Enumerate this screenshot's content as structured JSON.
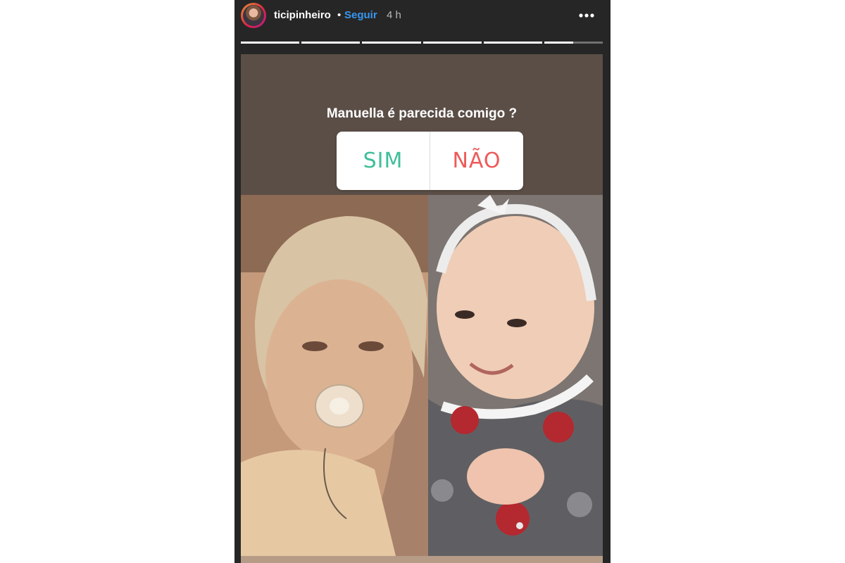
{
  "story": {
    "username": "ticipinheiro",
    "separator": "•",
    "follow_label": "Seguir",
    "time_ago": "4 h",
    "avatar_icon": "profile-avatar",
    "more_icon": "more-horizontal-icon",
    "progress_segments": [
      {
        "fill": 1
      },
      {
        "fill": 1
      },
      {
        "fill": 1
      },
      {
        "fill": 1
      },
      {
        "fill": 1
      },
      {
        "fill": 0.5
      }
    ]
  },
  "poll": {
    "question": "Manuella é parecida comigo ?",
    "options": [
      {
        "label": "SIM",
        "color": "#3fbf9a"
      },
      {
        "label": "NÃO",
        "color": "#ee5a5a"
      }
    ]
  },
  "colors": {
    "background": "#262626",
    "follow": "#3897f0"
  }
}
